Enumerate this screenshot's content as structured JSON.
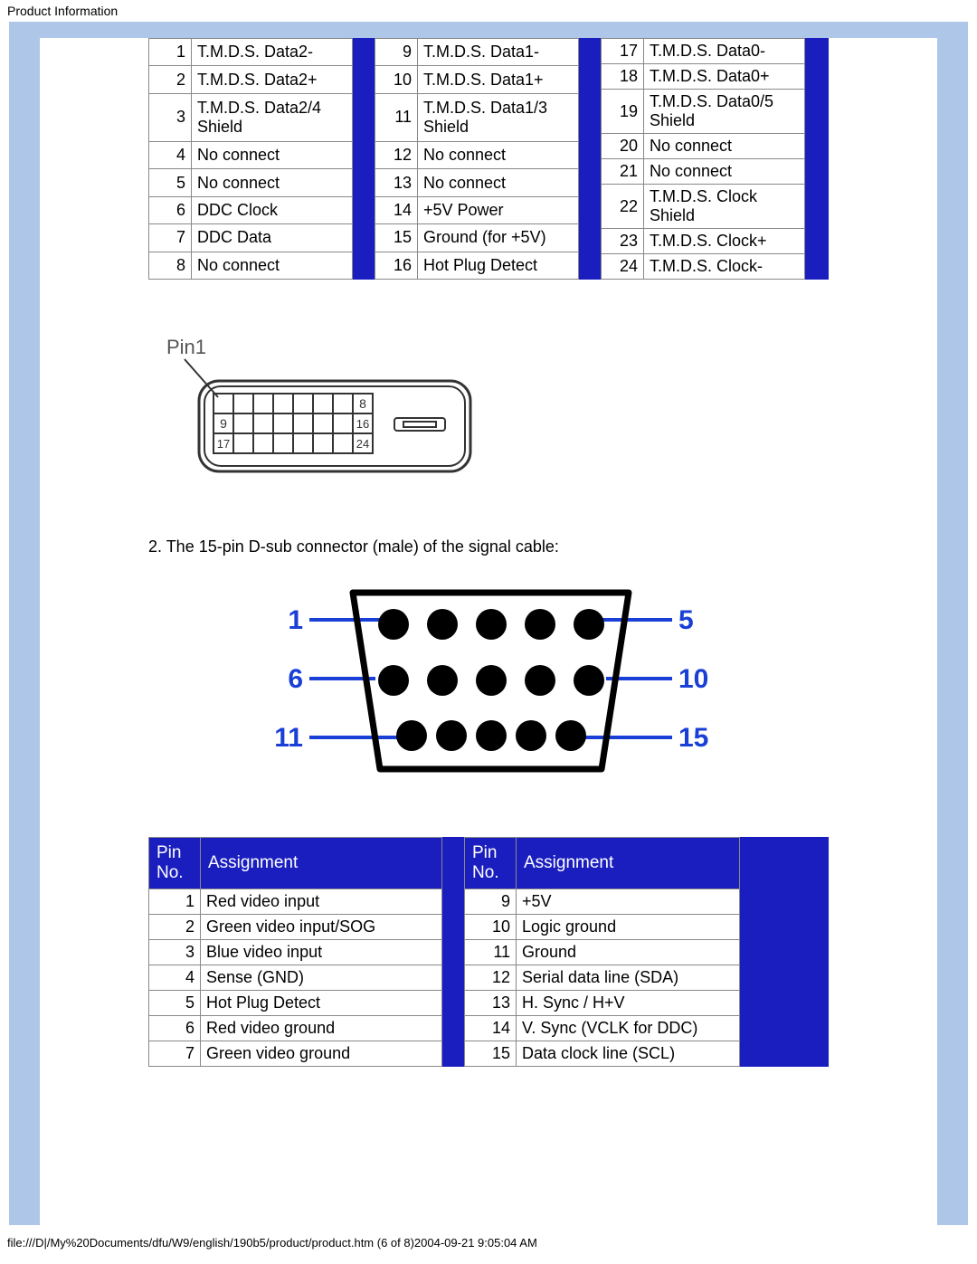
{
  "page_header": "Product Information",
  "page_footer": "file:///D|/My%20Documents/dfu/W9/english/190b5/product/product.htm (6 of 8)2004-09-21 9:05:04 AM",
  "table_top": {
    "col1": [
      {
        "n": "1",
        "s": "T.M.D.S. Data2-"
      },
      {
        "n": "2",
        "s": "T.M.D.S. Data2+"
      },
      {
        "n": "3",
        "s": "T.M.D.S. Data2/4 Shield"
      },
      {
        "n": "4",
        "s": "No connect"
      },
      {
        "n": "5",
        "s": "No connect"
      },
      {
        "n": "6",
        "s": "DDC Clock"
      },
      {
        "n": "7",
        "s": "DDC Data"
      },
      {
        "n": "8",
        "s": "No connect"
      }
    ],
    "col2": [
      {
        "n": "9",
        "s": "T.M.D.S. Data1-"
      },
      {
        "n": "10",
        "s": "T.M.D.S. Data1+"
      },
      {
        "n": "11",
        "s": "T.M.D.S. Data1/3 Shield"
      },
      {
        "n": "12",
        "s": "No connect"
      },
      {
        "n": "13",
        "s": "No connect"
      },
      {
        "n": "14",
        "s": "+5V Power"
      },
      {
        "n": "15",
        "s": "Ground (for +5V)"
      },
      {
        "n": "16",
        "s": "Hot Plug Detect"
      }
    ],
    "col3": [
      {
        "n": "17",
        "s": "T.M.D.S. Data0-"
      },
      {
        "n": "18",
        "s": "T.M.D.S. Data0+"
      },
      {
        "n": "19",
        "s": "T.M.D.S. Data0/5 Shield"
      },
      {
        "n": "20",
        "s": "No connect"
      },
      {
        "n": "21",
        "s": "No connect"
      },
      {
        "n": "22",
        "s": "T.M.D.S. Clock Shield"
      },
      {
        "n": "23",
        "s": "T.M.D.S. Clock+"
      },
      {
        "n": "24",
        "s": "T.M.D.S. Clock-"
      }
    ]
  },
  "diagram": {
    "pin1_label": "Pin1",
    "row_end_labels": [
      "8",
      "16",
      "24"
    ],
    "row_start_labels": [
      "",
      "9",
      "17"
    ]
  },
  "section2_caption": "2. The 15-pin D-sub connector (male) of the signal cable:",
  "dsub": {
    "left_labels": [
      "1",
      "6",
      "11"
    ],
    "right_labels": [
      "5",
      "10",
      "15"
    ]
  },
  "table_bottom": {
    "headers": {
      "pin": "Pin No.",
      "assign": "Assignment"
    },
    "col1": [
      {
        "n": "1",
        "s": "Red video input"
      },
      {
        "n": "2",
        "s": "Green video input/SOG"
      },
      {
        "n": "3",
        "s": "Blue video input"
      },
      {
        "n": "4",
        "s": "Sense (GND)"
      },
      {
        "n": "5",
        "s": "Hot Plug Detect"
      },
      {
        "n": "6",
        "s": "Red video ground"
      },
      {
        "n": "7",
        "s": "Green video ground"
      }
    ],
    "col2": [
      {
        "n": "9",
        "s": "+5V"
      },
      {
        "n": "10",
        "s": "Logic ground"
      },
      {
        "n": "11",
        "s": "Ground"
      },
      {
        "n": "12",
        "s": "Serial data line (SDA)"
      },
      {
        "n": "13",
        "s": "H. Sync / H+V"
      },
      {
        "n": "14",
        "s": "V. Sync (VCLK for DDC)"
      },
      {
        "n": "15",
        "s": "Data clock line (SCL)"
      }
    ]
  }
}
